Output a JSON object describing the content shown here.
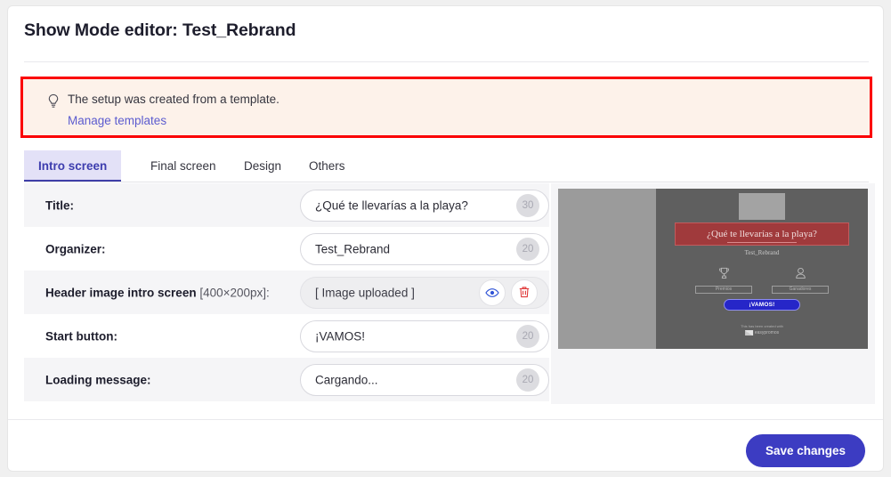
{
  "modal": {
    "title": "Show Mode editor: Test_Rebrand"
  },
  "alert": {
    "icon": "lightbulb-icon",
    "message": "The setup was created from a template.",
    "link_label": "Manage templates",
    "background": "#fdf2ea",
    "highlight_color": "#fb0003"
  },
  "tabs": [
    {
      "label": "Intro screen",
      "active": true
    },
    {
      "label": "Final screen",
      "active": false
    },
    {
      "label": "Design",
      "active": false
    },
    {
      "label": "Others",
      "active": false
    }
  ],
  "form": {
    "rows": [
      {
        "label": "Title:",
        "dimension": "",
        "value": "¿Qué te llevarías a la playa?",
        "counter": "30",
        "striped": true,
        "type": "text"
      },
      {
        "label": "Organizer:",
        "dimension": "",
        "value": "Test_Rebrand",
        "counter": "20",
        "striped": false,
        "type": "text"
      },
      {
        "label": "Header image intro screen",
        "dimension": "[400×200px]:",
        "value": "[ Image uploaded ]",
        "counter": "",
        "striped": true,
        "type": "image"
      },
      {
        "label": "Start button:",
        "dimension": "",
        "value": "¡VAMOS!",
        "counter": "20",
        "striped": false,
        "type": "text"
      },
      {
        "label": "Loading message:",
        "dimension": "",
        "value": "Cargando...",
        "counter": "20",
        "striped": true,
        "type": "text"
      }
    ],
    "image_actions": {
      "preview_icon": "eye-icon",
      "delete_icon": "trash-icon"
    }
  },
  "preview": {
    "title": "¿Qué te llevarías a la playa?",
    "organizer": "Test_Rebrand",
    "chips": [
      {
        "icon": "trophy-icon",
        "label": "Premios"
      },
      {
        "icon": "person-icon",
        "label": "Ganadores"
      }
    ],
    "start_button": "¡VAMOS!",
    "footer_text": "This has been created with",
    "footer_brand": "easypromos",
    "banner_color": "#a03a3c",
    "button_color": "#2626c8"
  },
  "footer": {
    "save_label": "Save changes",
    "save_color": "#3c3cc2"
  }
}
